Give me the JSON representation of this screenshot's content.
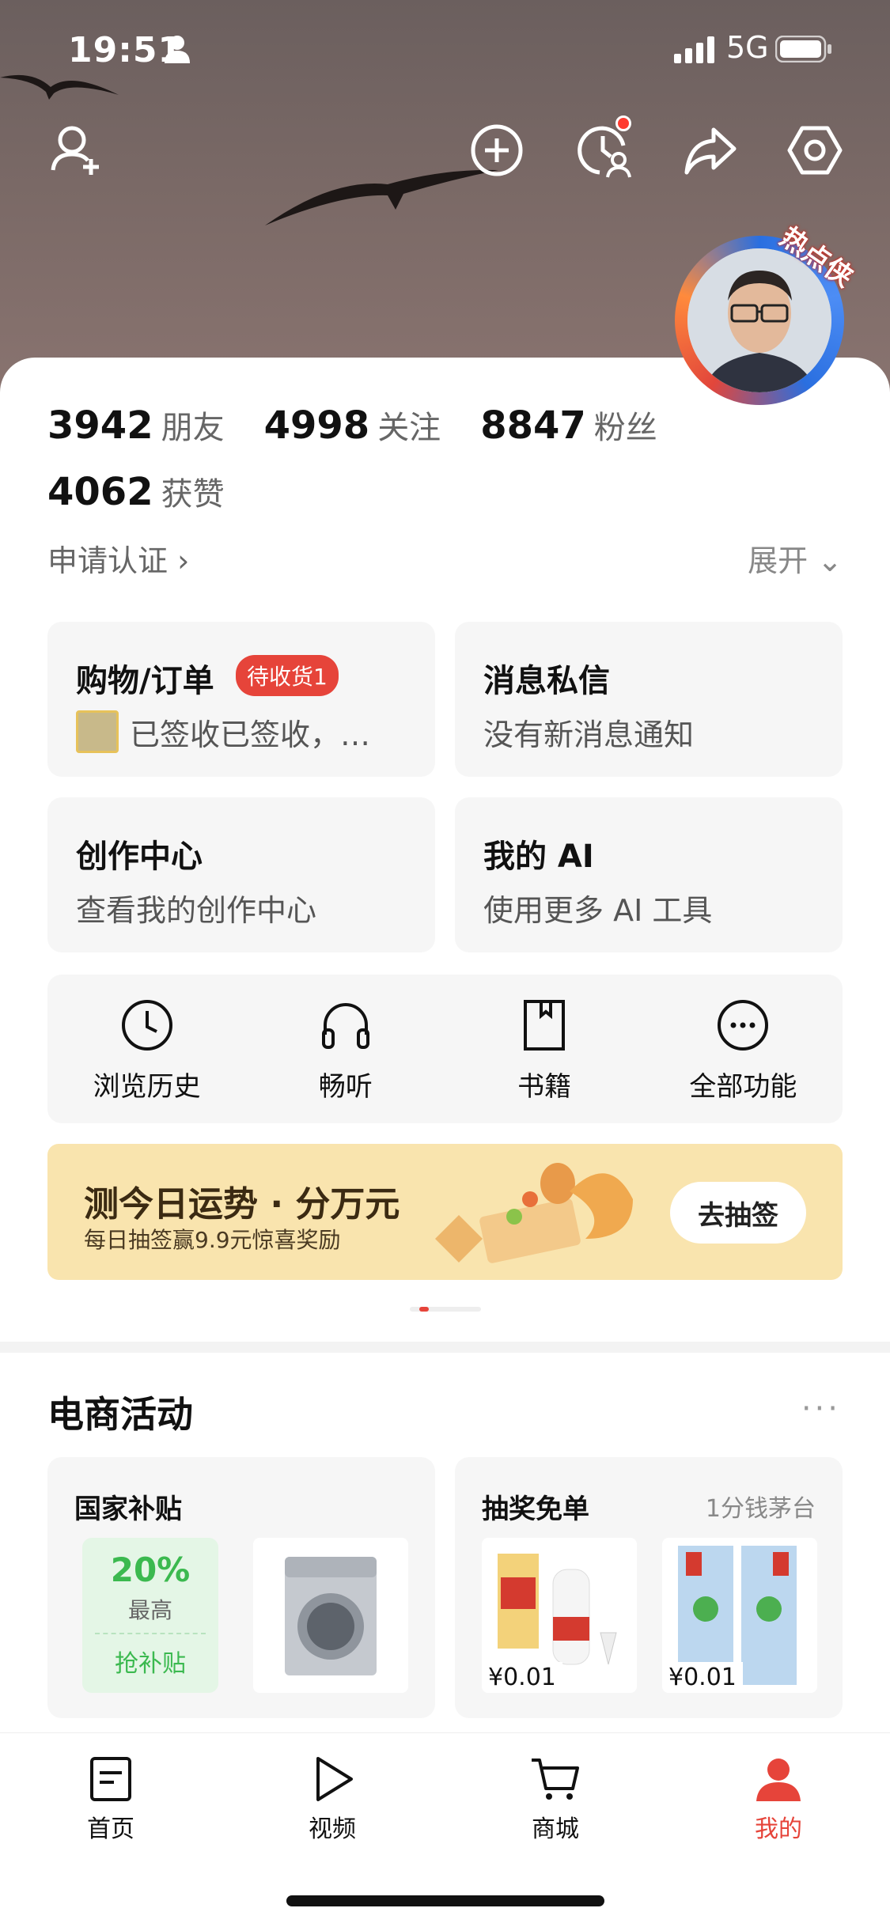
{
  "status_bar": {
    "time": "19:51",
    "network": "5G"
  },
  "avatar": {
    "badge": "热点侠"
  },
  "stats": [
    {
      "num": "3942",
      "label": "朋友"
    },
    {
      "num": "4998",
      "label": "关注"
    },
    {
      "num": "8847",
      "label": "粉丝"
    },
    {
      "num": "4062",
      "label": "获赞"
    }
  ],
  "profile": {
    "cert": "申请认证 ›",
    "expand": "展开 ⌄"
  },
  "cards": {
    "shopping": {
      "title": "购物/订单",
      "badge": "待收货1",
      "sub": "已签收已签收，…"
    },
    "messages": {
      "title": "消息私信",
      "sub": "没有新消息通知"
    },
    "creator": {
      "title": "创作中心",
      "sub": "查看我的创作中心"
    },
    "ai": {
      "title": "我的 AI",
      "sub": "使用更多 AI 工具"
    }
  },
  "tools": [
    "浏览历史",
    "畅听",
    "书籍",
    "全部功能"
  ],
  "banner": {
    "title": "测今日运势 · 分万元",
    "sub": "每日抽签赢9.9元惊喜奖励",
    "button": "去抽签"
  },
  "ecommerce": {
    "title": "电商活动",
    "more": "···",
    "subsidy_card": {
      "title": "国家补贴",
      "pct": "20%",
      "max": "最高",
      "grab": "抢补贴"
    },
    "lottery_card": {
      "title": "抽奖免单",
      "tag": "1分钱茅台",
      "price1": "¥0.01",
      "price2": "¥0.01"
    }
  },
  "tabbar": [
    {
      "label": "首页",
      "active": false
    },
    {
      "label": "视频",
      "active": false
    },
    {
      "label": "商城",
      "active": false
    },
    {
      "label": "我的",
      "active": true
    }
  ],
  "colors": {
    "accent": "#e6443a",
    "green": "#3bb94f",
    "banner_bg": "#f9e4ae"
  }
}
